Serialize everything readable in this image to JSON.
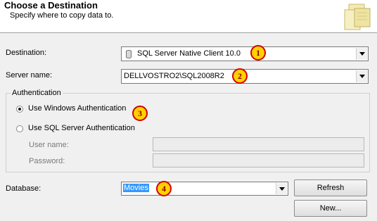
{
  "header": {
    "title": "Choose a Destination",
    "subtitle": "Specify where to copy data to."
  },
  "destination": {
    "label": "Destination:",
    "value": "SQL Server Native Client 10.0",
    "icon": "database-icon",
    "badge": "1"
  },
  "server": {
    "label": "Server name:",
    "value": "DELLVOSTRO2\\SQL2008R2",
    "badge": "2"
  },
  "authentication": {
    "legend": "Authentication",
    "windows_label": "Use Windows Authentication",
    "windows_selected": true,
    "sql_label": "Use SQL Server Authentication",
    "sql_selected": false,
    "badge": "3",
    "user_label": "User name:",
    "user_value": "",
    "password_label": "Password:",
    "password_value": ""
  },
  "database": {
    "label": "Database:",
    "value": "Movies",
    "badge": "4"
  },
  "buttons": {
    "refresh": "Refresh",
    "new": "New..."
  },
  "colors": {
    "badge_fill": "#ffd200",
    "badge_border": "#d40000",
    "selection": "#3399ff"
  }
}
